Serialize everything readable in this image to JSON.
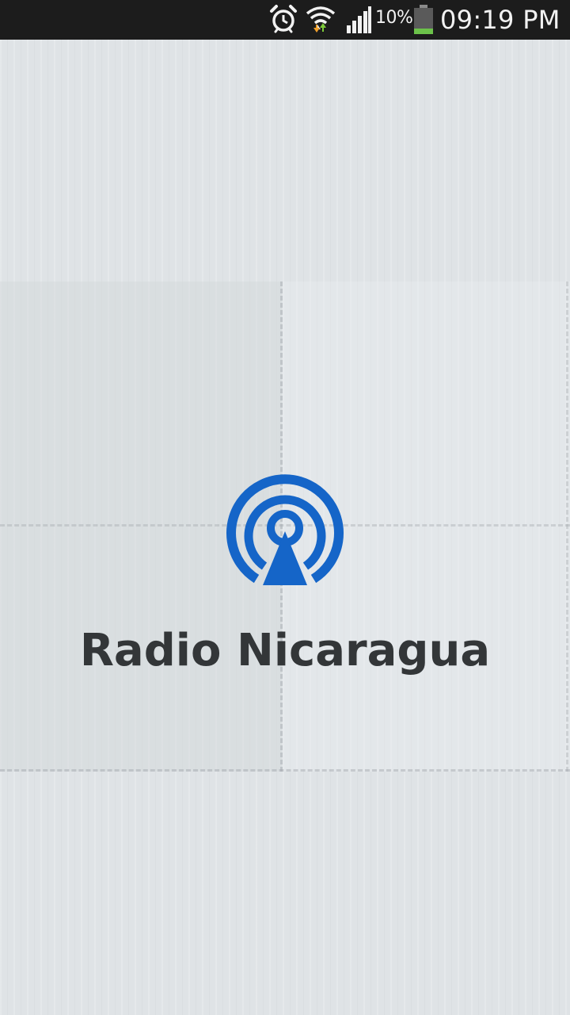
{
  "status_bar": {
    "battery_percent": "10%",
    "time": "09:19 PM",
    "icons": [
      "alarm-icon",
      "wifi-icon",
      "signal-icon",
      "battery-icon"
    ]
  },
  "splash": {
    "app_name": "Radio Nicaragua",
    "logo_icon": "radio-broadcast-icon"
  },
  "colors": {
    "logo_blue": "#1565c8",
    "title_text": "#333638",
    "background": "#dfe3e6",
    "status_bar": "#1c1c1c",
    "battery_fill": "#6cc24a"
  }
}
